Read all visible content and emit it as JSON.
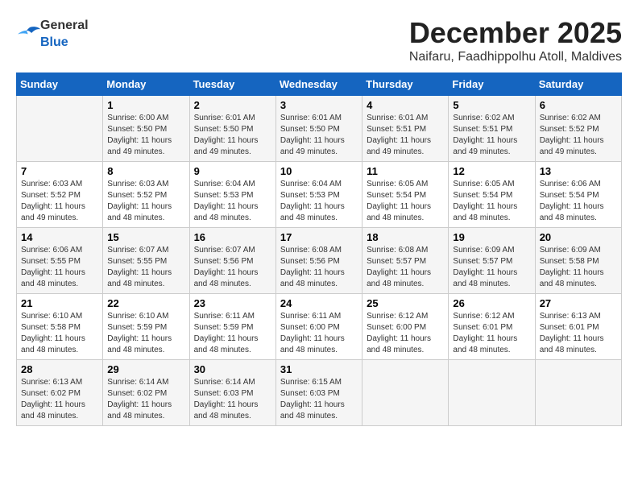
{
  "logo": {
    "general": "General",
    "blue": "Blue"
  },
  "header": {
    "month": "December 2025",
    "location": "Naifaru, Faadhippolhu Atoll, Maldives"
  },
  "weekdays": [
    "Sunday",
    "Monday",
    "Tuesday",
    "Wednesday",
    "Thursday",
    "Friday",
    "Saturday"
  ],
  "weeks": [
    [
      {
        "day": "",
        "info": ""
      },
      {
        "day": "1",
        "info": "Sunrise: 6:00 AM\nSunset: 5:50 PM\nDaylight: 11 hours\nand 49 minutes."
      },
      {
        "day": "2",
        "info": "Sunrise: 6:01 AM\nSunset: 5:50 PM\nDaylight: 11 hours\nand 49 minutes."
      },
      {
        "day": "3",
        "info": "Sunrise: 6:01 AM\nSunset: 5:50 PM\nDaylight: 11 hours\nand 49 minutes."
      },
      {
        "day": "4",
        "info": "Sunrise: 6:01 AM\nSunset: 5:51 PM\nDaylight: 11 hours\nand 49 minutes."
      },
      {
        "day": "5",
        "info": "Sunrise: 6:02 AM\nSunset: 5:51 PM\nDaylight: 11 hours\nand 49 minutes."
      },
      {
        "day": "6",
        "info": "Sunrise: 6:02 AM\nSunset: 5:52 PM\nDaylight: 11 hours\nand 49 minutes."
      }
    ],
    [
      {
        "day": "7",
        "info": "Sunrise: 6:03 AM\nSunset: 5:52 PM\nDaylight: 11 hours\nand 49 minutes."
      },
      {
        "day": "8",
        "info": "Sunrise: 6:03 AM\nSunset: 5:52 PM\nDaylight: 11 hours\nand 48 minutes."
      },
      {
        "day": "9",
        "info": "Sunrise: 6:04 AM\nSunset: 5:53 PM\nDaylight: 11 hours\nand 48 minutes."
      },
      {
        "day": "10",
        "info": "Sunrise: 6:04 AM\nSunset: 5:53 PM\nDaylight: 11 hours\nand 48 minutes."
      },
      {
        "day": "11",
        "info": "Sunrise: 6:05 AM\nSunset: 5:54 PM\nDaylight: 11 hours\nand 48 minutes."
      },
      {
        "day": "12",
        "info": "Sunrise: 6:05 AM\nSunset: 5:54 PM\nDaylight: 11 hours\nand 48 minutes."
      },
      {
        "day": "13",
        "info": "Sunrise: 6:06 AM\nSunset: 5:54 PM\nDaylight: 11 hours\nand 48 minutes."
      }
    ],
    [
      {
        "day": "14",
        "info": "Sunrise: 6:06 AM\nSunset: 5:55 PM\nDaylight: 11 hours\nand 48 minutes."
      },
      {
        "day": "15",
        "info": "Sunrise: 6:07 AM\nSunset: 5:55 PM\nDaylight: 11 hours\nand 48 minutes."
      },
      {
        "day": "16",
        "info": "Sunrise: 6:07 AM\nSunset: 5:56 PM\nDaylight: 11 hours\nand 48 minutes."
      },
      {
        "day": "17",
        "info": "Sunrise: 6:08 AM\nSunset: 5:56 PM\nDaylight: 11 hours\nand 48 minutes."
      },
      {
        "day": "18",
        "info": "Sunrise: 6:08 AM\nSunset: 5:57 PM\nDaylight: 11 hours\nand 48 minutes."
      },
      {
        "day": "19",
        "info": "Sunrise: 6:09 AM\nSunset: 5:57 PM\nDaylight: 11 hours\nand 48 minutes."
      },
      {
        "day": "20",
        "info": "Sunrise: 6:09 AM\nSunset: 5:58 PM\nDaylight: 11 hours\nand 48 minutes."
      }
    ],
    [
      {
        "day": "21",
        "info": "Sunrise: 6:10 AM\nSunset: 5:58 PM\nDaylight: 11 hours\nand 48 minutes."
      },
      {
        "day": "22",
        "info": "Sunrise: 6:10 AM\nSunset: 5:59 PM\nDaylight: 11 hours\nand 48 minutes."
      },
      {
        "day": "23",
        "info": "Sunrise: 6:11 AM\nSunset: 5:59 PM\nDaylight: 11 hours\nand 48 minutes."
      },
      {
        "day": "24",
        "info": "Sunrise: 6:11 AM\nSunset: 6:00 PM\nDaylight: 11 hours\nand 48 minutes."
      },
      {
        "day": "25",
        "info": "Sunrise: 6:12 AM\nSunset: 6:00 PM\nDaylight: 11 hours\nand 48 minutes."
      },
      {
        "day": "26",
        "info": "Sunrise: 6:12 AM\nSunset: 6:01 PM\nDaylight: 11 hours\nand 48 minutes."
      },
      {
        "day": "27",
        "info": "Sunrise: 6:13 AM\nSunset: 6:01 PM\nDaylight: 11 hours\nand 48 minutes."
      }
    ],
    [
      {
        "day": "28",
        "info": "Sunrise: 6:13 AM\nSunset: 6:02 PM\nDaylight: 11 hours\nand 48 minutes."
      },
      {
        "day": "29",
        "info": "Sunrise: 6:14 AM\nSunset: 6:02 PM\nDaylight: 11 hours\nand 48 minutes."
      },
      {
        "day": "30",
        "info": "Sunrise: 6:14 AM\nSunset: 6:03 PM\nDaylight: 11 hours\nand 48 minutes."
      },
      {
        "day": "31",
        "info": "Sunrise: 6:15 AM\nSunset: 6:03 PM\nDaylight: 11 hours\nand 48 minutes."
      },
      {
        "day": "",
        "info": ""
      },
      {
        "day": "",
        "info": ""
      },
      {
        "day": "",
        "info": ""
      }
    ]
  ]
}
